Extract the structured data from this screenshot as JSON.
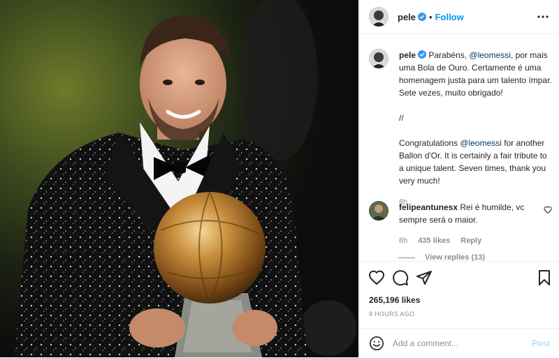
{
  "post": {
    "author": "pele",
    "follow_label": "Follow",
    "separator": "•",
    "caption_pt_before": "Parabéns, ",
    "caption_pt_mention": "@leomessi",
    "caption_pt_after": ", por mais uma Bola de Ouro. Certamente é uma homenagem justa para um talento ímpar. Sete vezes, muito obrigado!",
    "caption_divider": "//",
    "caption_en_before": "Congratulations ",
    "caption_en_mention": "@leomessi",
    "caption_en_after": " for another Ballon d'Or. It is certainly a fair tribute to a unique talent. Seven times, thank you very much!",
    "caption_age": "8h",
    "likes": "265,196 likes",
    "posted_ago": "8 HOURS AGO"
  },
  "comments": [
    {
      "author": "felipeantunesx",
      "text": "Rei é humilde, vc sempre será o maior.",
      "age": "8h",
      "likes": "435 likes",
      "reply_label": "Reply"
    }
  ],
  "view_replies": "View replies (13)",
  "composer": {
    "placeholder": "Add a comment...",
    "post_label": "Post"
  },
  "icons": {
    "verified": "verified-badge-icon",
    "more": "more-options-icon",
    "like": "heart-icon",
    "comment": "comment-bubble-icon",
    "share": "paper-plane-icon",
    "save": "bookmark-icon",
    "emoji": "emoji-smile-icon"
  },
  "colors": {
    "accent": "#0095f6",
    "mention": "#00376b",
    "muted": "#8e8e8e",
    "post_disabled": "#b2dffc"
  }
}
